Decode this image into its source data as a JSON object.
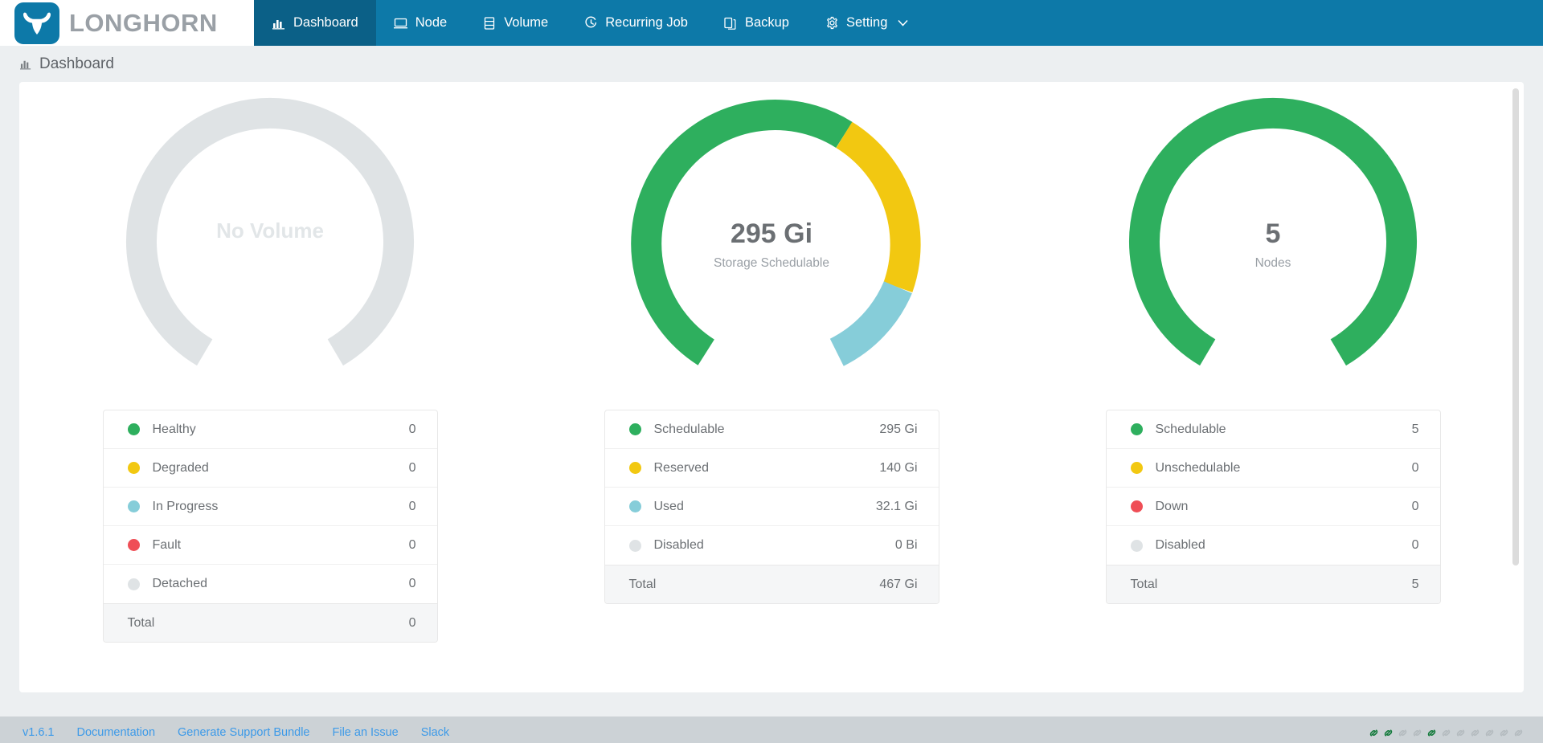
{
  "brand": {
    "name": "LONGHORN",
    "logo_icon": "longhorn-bull-icon",
    "logo_bg": "#0d79a8"
  },
  "nav": {
    "items": [
      {
        "label": "Dashboard",
        "icon": "bar-chart-icon",
        "active": true
      },
      {
        "label": "Node",
        "icon": "server-icon",
        "active": false
      },
      {
        "label": "Volume",
        "icon": "storage-icon",
        "active": false
      },
      {
        "label": "Recurring Job",
        "icon": "clock-icon",
        "active": false
      },
      {
        "label": "Backup",
        "icon": "copy-icon",
        "active": false
      },
      {
        "label": "Setting",
        "icon": "gear-icon",
        "active": false,
        "has_chevron": true
      }
    ]
  },
  "breadcrumb": {
    "icon": "bar-chart-icon",
    "label": "Dashboard"
  },
  "colors": {
    "green": "#2eaf5e",
    "yellow": "#f2c811",
    "cyan": "#86cdd9",
    "red": "#ef4e56",
    "gray": "#dfe3e5",
    "header_blue": "#0d79a8",
    "active_blue": "#0b6087",
    "link_blue": "#3d9ae8"
  },
  "chart_data": [
    {
      "type": "pie",
      "title": "Volume",
      "center_value": "No Volume",
      "center_label": "",
      "empty": true,
      "categories": [
        "Healthy",
        "Degraded",
        "In Progress",
        "Fault",
        "Detached"
      ],
      "values": [
        0,
        0,
        0,
        0,
        0
      ],
      "colors": [
        "#2eaf5e",
        "#f2c811",
        "#86cdd9",
        "#ef4e56",
        "#dfe3e5"
      ],
      "total_label": "Total",
      "total_value": "0",
      "display_values": [
        "0",
        "0",
        "0",
        "0",
        "0"
      ]
    },
    {
      "type": "pie",
      "title": "Storage",
      "center_value": "295 Gi",
      "center_label": "Storage Schedulable",
      "empty": false,
      "categories": [
        "Schedulable",
        "Reserved",
        "Used",
        "Disabled"
      ],
      "values": [
        295,
        140,
        32.1,
        0
      ],
      "display_values": [
        "295 Gi",
        "140 Gi",
        "32.1 Gi",
        "0 Bi"
      ],
      "colors": [
        "#2eaf5e",
        "#f2c811",
        "#86cdd9",
        "#dfe3e5"
      ],
      "total_label": "Total",
      "total_value": "467 Gi",
      "unit": "Gi"
    },
    {
      "type": "pie",
      "title": "Node",
      "center_value": "5",
      "center_label": "Nodes",
      "empty": false,
      "categories": [
        "Schedulable",
        "Unschedulable",
        "Down",
        "Disabled"
      ],
      "values": [
        5,
        0,
        0,
        0
      ],
      "display_values": [
        "5",
        "0",
        "0",
        "0"
      ],
      "colors": [
        "#2eaf5e",
        "#f2c811",
        "#ef4e56",
        "#dfe3e5"
      ],
      "total_label": "Total",
      "total_value": "5"
    }
  ],
  "footer": {
    "version": "v1.6.1",
    "links": [
      {
        "label": "Documentation"
      },
      {
        "label": "Generate Support Bundle"
      },
      {
        "label": "File an Issue"
      },
      {
        "label": "Slack"
      }
    ],
    "status_icons": [
      {
        "icon": "chain-link-icon",
        "state": "active"
      },
      {
        "icon": "chain-link-icon",
        "state": "active"
      },
      {
        "icon": "chain-link-icon",
        "state": "inactive"
      },
      {
        "icon": "chain-link-icon",
        "state": "inactive"
      },
      {
        "icon": "chain-link-icon",
        "state": "active"
      },
      {
        "icon": "chain-link-icon",
        "state": "inactive"
      },
      {
        "icon": "chain-link-icon",
        "state": "inactive"
      },
      {
        "icon": "chain-link-icon",
        "state": "inactive"
      },
      {
        "icon": "chain-link-icon",
        "state": "inactive"
      },
      {
        "icon": "chain-link-icon",
        "state": "inactive"
      },
      {
        "icon": "chain-link-icon",
        "state": "inactive"
      }
    ]
  }
}
